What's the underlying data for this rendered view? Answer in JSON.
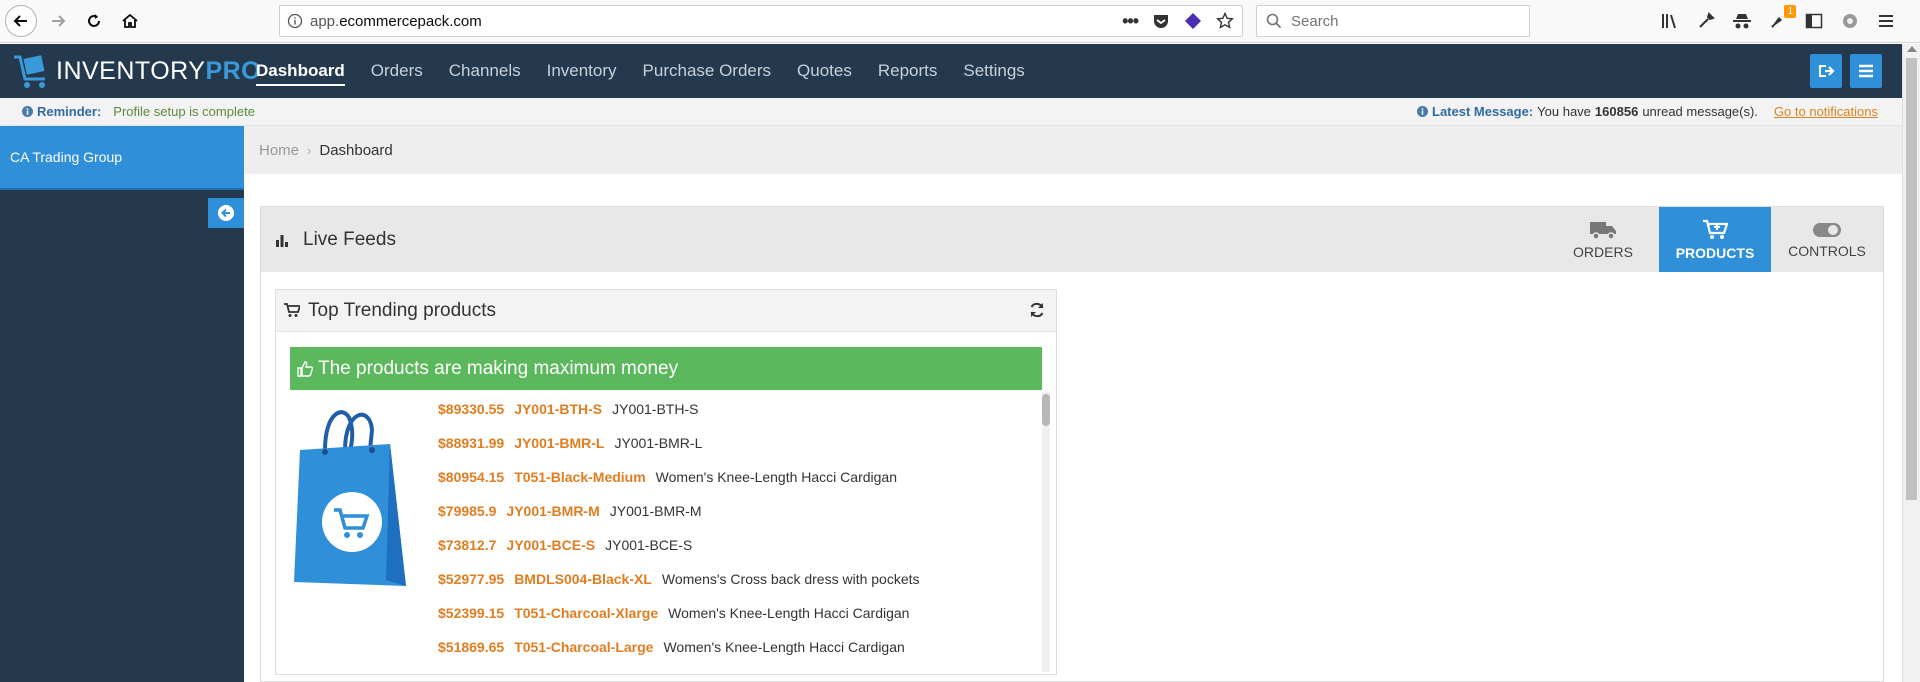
{
  "browser": {
    "url_prefix": "app.",
    "url_domain": "ecommercepack.com",
    "search_placeholder": "Search",
    "notification_count": "1"
  },
  "header": {
    "logo_main": "INVENTORY",
    "logo_accent": "PRO",
    "nav": [
      {
        "label": "Dashboard",
        "active": true
      },
      {
        "label": "Orders"
      },
      {
        "label": "Channels"
      },
      {
        "label": "Inventory"
      },
      {
        "label": "Purchase Orders"
      },
      {
        "label": "Quotes"
      },
      {
        "label": "Reports"
      },
      {
        "label": "Settings"
      }
    ]
  },
  "reminder": {
    "label": "Reminder:",
    "text": "Profile setup is complete",
    "latest_label": "Latest Message:",
    "message_prefix": "You have",
    "message_count": "160856",
    "message_suffix": "unread message(s).",
    "link": "Go to notifications"
  },
  "sidebar": {
    "company": "CA Trading Group"
  },
  "breadcrumb": {
    "home": "Home",
    "current": "Dashboard"
  },
  "live_feeds": {
    "title": "Live Feeds",
    "tabs": [
      {
        "label": "ORDERS",
        "icon": "truck-icon"
      },
      {
        "label": "PRODUCTS",
        "icon": "cart-plus-icon",
        "active": true
      },
      {
        "label": "CONTROLS",
        "icon": "toggle-icon"
      }
    ]
  },
  "trending": {
    "title": "Top Trending products",
    "banner": "The products are making maximum money",
    "products": [
      {
        "price": "$89330.55",
        "sku": "JY001-BTH-S",
        "name": "JY001-BTH-S"
      },
      {
        "price": "$88931.99",
        "sku": "JY001-BMR-L",
        "name": "JY001-BMR-L"
      },
      {
        "price": "$80954.15",
        "sku": "T051-Black-Medium",
        "name": "Women's Knee-Length Hacci Cardigan"
      },
      {
        "price": "$79985.9",
        "sku": "JY001-BMR-M",
        "name": "JY001-BMR-M"
      },
      {
        "price": "$73812.7",
        "sku": "JY001-BCE-S",
        "name": "JY001-BCE-S"
      },
      {
        "price": "$52977.95",
        "sku": "BMDLS004-Black-XL",
        "name": "Womens's Cross back dress with pockets"
      },
      {
        "price": "$52399.15",
        "sku": "T051-Charcoal-Xlarge",
        "name": "Women's Knee-Length Hacci Cardigan"
      },
      {
        "price": "$51869.65",
        "sku": "T051-Charcoal-Large",
        "name": "Women's Knee-Length Hacci Cardigan"
      }
    ]
  },
  "colors": {
    "header_bg": "#25394e",
    "accent_blue": "#2f8fd8",
    "success_green": "#5cb85c",
    "price_orange": "#e07d20"
  }
}
